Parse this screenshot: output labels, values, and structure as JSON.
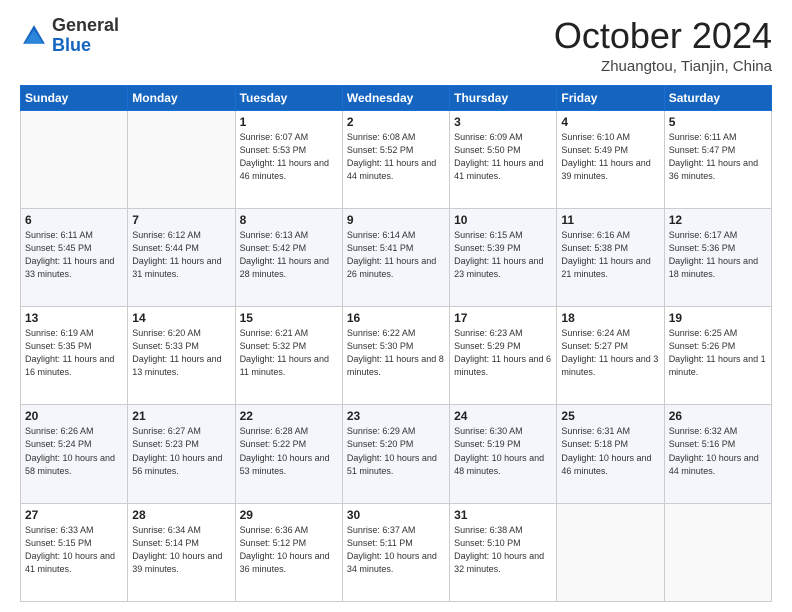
{
  "header": {
    "logo_general": "General",
    "logo_blue": "Blue",
    "month_title": "October 2024",
    "subtitle": "Zhuangtou, Tianjin, China"
  },
  "days_of_week": [
    "Sunday",
    "Monday",
    "Tuesday",
    "Wednesday",
    "Thursday",
    "Friday",
    "Saturday"
  ],
  "weeks": [
    [
      {
        "day": "",
        "info": ""
      },
      {
        "day": "",
        "info": ""
      },
      {
        "day": "1",
        "info": "Sunrise: 6:07 AM\nSunset: 5:53 PM\nDaylight: 11 hours and 46 minutes."
      },
      {
        "day": "2",
        "info": "Sunrise: 6:08 AM\nSunset: 5:52 PM\nDaylight: 11 hours and 44 minutes."
      },
      {
        "day": "3",
        "info": "Sunrise: 6:09 AM\nSunset: 5:50 PM\nDaylight: 11 hours and 41 minutes."
      },
      {
        "day": "4",
        "info": "Sunrise: 6:10 AM\nSunset: 5:49 PM\nDaylight: 11 hours and 39 minutes."
      },
      {
        "day": "5",
        "info": "Sunrise: 6:11 AM\nSunset: 5:47 PM\nDaylight: 11 hours and 36 minutes."
      }
    ],
    [
      {
        "day": "6",
        "info": "Sunrise: 6:11 AM\nSunset: 5:45 PM\nDaylight: 11 hours and 33 minutes."
      },
      {
        "day": "7",
        "info": "Sunrise: 6:12 AM\nSunset: 5:44 PM\nDaylight: 11 hours and 31 minutes."
      },
      {
        "day": "8",
        "info": "Sunrise: 6:13 AM\nSunset: 5:42 PM\nDaylight: 11 hours and 28 minutes."
      },
      {
        "day": "9",
        "info": "Sunrise: 6:14 AM\nSunset: 5:41 PM\nDaylight: 11 hours and 26 minutes."
      },
      {
        "day": "10",
        "info": "Sunrise: 6:15 AM\nSunset: 5:39 PM\nDaylight: 11 hours and 23 minutes."
      },
      {
        "day": "11",
        "info": "Sunrise: 6:16 AM\nSunset: 5:38 PM\nDaylight: 11 hours and 21 minutes."
      },
      {
        "day": "12",
        "info": "Sunrise: 6:17 AM\nSunset: 5:36 PM\nDaylight: 11 hours and 18 minutes."
      }
    ],
    [
      {
        "day": "13",
        "info": "Sunrise: 6:19 AM\nSunset: 5:35 PM\nDaylight: 11 hours and 16 minutes."
      },
      {
        "day": "14",
        "info": "Sunrise: 6:20 AM\nSunset: 5:33 PM\nDaylight: 11 hours and 13 minutes."
      },
      {
        "day": "15",
        "info": "Sunrise: 6:21 AM\nSunset: 5:32 PM\nDaylight: 11 hours and 11 minutes."
      },
      {
        "day": "16",
        "info": "Sunrise: 6:22 AM\nSunset: 5:30 PM\nDaylight: 11 hours and 8 minutes."
      },
      {
        "day": "17",
        "info": "Sunrise: 6:23 AM\nSunset: 5:29 PM\nDaylight: 11 hours and 6 minutes."
      },
      {
        "day": "18",
        "info": "Sunrise: 6:24 AM\nSunset: 5:27 PM\nDaylight: 11 hours and 3 minutes."
      },
      {
        "day": "19",
        "info": "Sunrise: 6:25 AM\nSunset: 5:26 PM\nDaylight: 11 hours and 1 minute."
      }
    ],
    [
      {
        "day": "20",
        "info": "Sunrise: 6:26 AM\nSunset: 5:24 PM\nDaylight: 10 hours and 58 minutes."
      },
      {
        "day": "21",
        "info": "Sunrise: 6:27 AM\nSunset: 5:23 PM\nDaylight: 10 hours and 56 minutes."
      },
      {
        "day": "22",
        "info": "Sunrise: 6:28 AM\nSunset: 5:22 PM\nDaylight: 10 hours and 53 minutes."
      },
      {
        "day": "23",
        "info": "Sunrise: 6:29 AM\nSunset: 5:20 PM\nDaylight: 10 hours and 51 minutes."
      },
      {
        "day": "24",
        "info": "Sunrise: 6:30 AM\nSunset: 5:19 PM\nDaylight: 10 hours and 48 minutes."
      },
      {
        "day": "25",
        "info": "Sunrise: 6:31 AM\nSunset: 5:18 PM\nDaylight: 10 hours and 46 minutes."
      },
      {
        "day": "26",
        "info": "Sunrise: 6:32 AM\nSunset: 5:16 PM\nDaylight: 10 hours and 44 minutes."
      }
    ],
    [
      {
        "day": "27",
        "info": "Sunrise: 6:33 AM\nSunset: 5:15 PM\nDaylight: 10 hours and 41 minutes."
      },
      {
        "day": "28",
        "info": "Sunrise: 6:34 AM\nSunset: 5:14 PM\nDaylight: 10 hours and 39 minutes."
      },
      {
        "day": "29",
        "info": "Sunrise: 6:36 AM\nSunset: 5:12 PM\nDaylight: 10 hours and 36 minutes."
      },
      {
        "day": "30",
        "info": "Sunrise: 6:37 AM\nSunset: 5:11 PM\nDaylight: 10 hours and 34 minutes."
      },
      {
        "day": "31",
        "info": "Sunrise: 6:38 AM\nSunset: 5:10 PM\nDaylight: 10 hours and 32 minutes."
      },
      {
        "day": "",
        "info": ""
      },
      {
        "day": "",
        "info": ""
      }
    ]
  ]
}
